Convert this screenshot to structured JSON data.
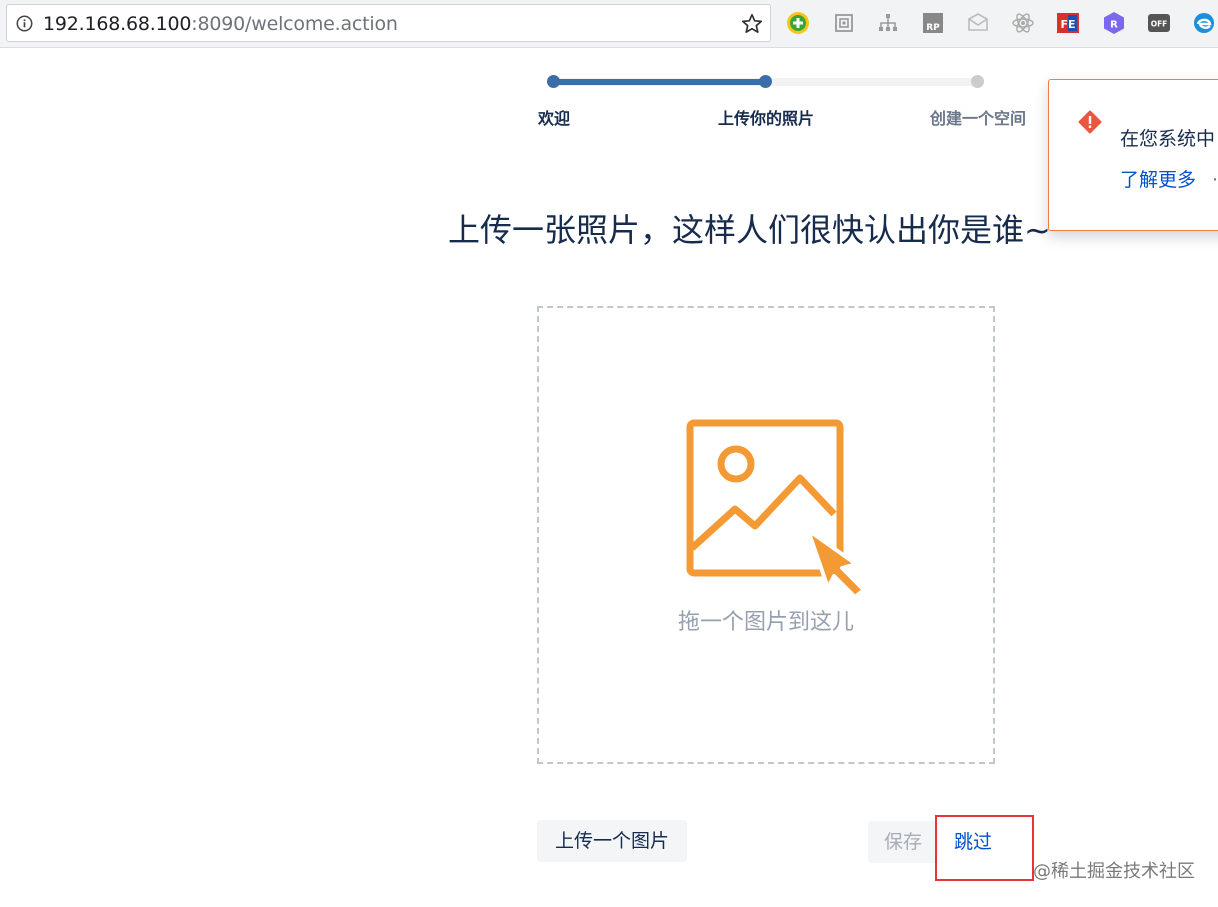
{
  "browser": {
    "url_host": "192.168.68.100",
    "url_rest": ":8090/welcome.action",
    "extensions": [
      {
        "name": "360-extension-icon",
        "text": ""
      },
      {
        "name": "qr-extension-icon",
        "text": ""
      },
      {
        "name": "sitemap-extension-icon",
        "text": ""
      },
      {
        "name": "rp-extension-icon",
        "text": "RP"
      },
      {
        "name": "mail-extension-icon",
        "text": ""
      },
      {
        "name": "react-extension-icon",
        "text": ""
      },
      {
        "name": "fe-extension-icon",
        "text": "FE"
      },
      {
        "name": "r-extension-icon",
        "text": "R"
      },
      {
        "name": "off-extension-icon",
        "text": "OFF"
      },
      {
        "name": "edge-extension-icon",
        "text": ""
      }
    ]
  },
  "stepper": {
    "steps": [
      {
        "label": "欢迎"
      },
      {
        "label": "上传你的照片"
      },
      {
        "label": "创建一个空间"
      }
    ],
    "current_step": 2,
    "total_steps": 3
  },
  "main": {
    "heading": "上传一张照片，这样人们很快认出你是谁~",
    "drop_hint": "拖一个图片到这儿"
  },
  "actions": {
    "upload_label": "上传一个图片",
    "save_label": "保存",
    "skip_label": "跳过"
  },
  "notification": {
    "text": "在您系统中",
    "link": "了解更多",
    "separator": "·"
  },
  "watermark": "@稀土掘金技术社区",
  "colors": {
    "accent": "#3b6ea9",
    "illustration": "#f39a35",
    "link": "#0052cc",
    "warning": "#e8573f",
    "highlight": "#e5343a"
  }
}
